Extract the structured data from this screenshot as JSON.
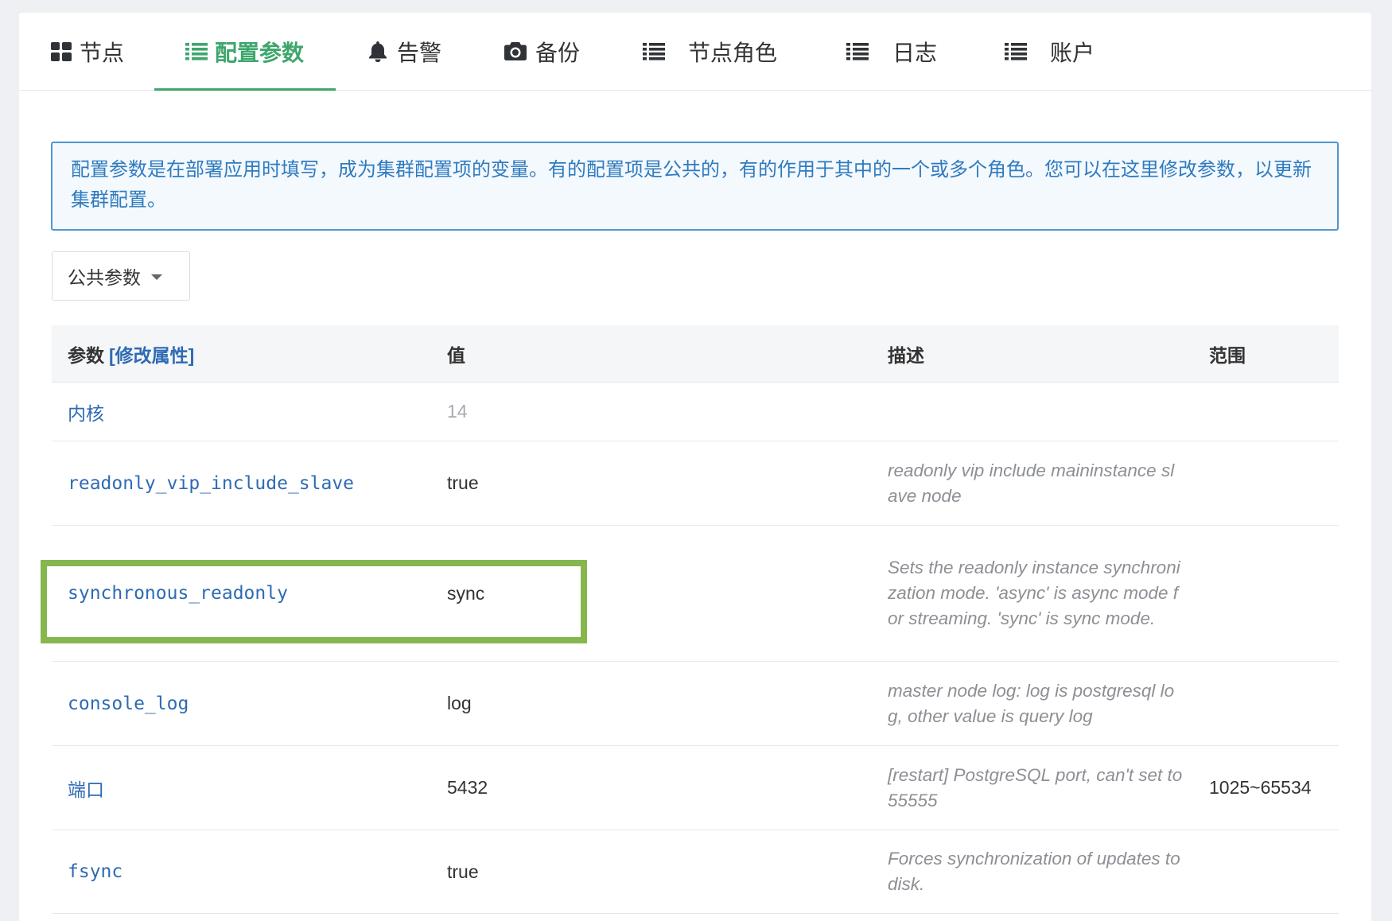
{
  "tabs": [
    {
      "label": "节点",
      "icon": "grid-icon"
    },
    {
      "label": "配置参数",
      "icon": "list-icon",
      "active": true
    },
    {
      "label": "告警",
      "icon": "bell-icon"
    },
    {
      "label": "备份",
      "icon": "camera-icon"
    },
    {
      "label": "节点角色",
      "icon": "list-icon"
    },
    {
      "label": "日志",
      "icon": "list-icon"
    },
    {
      "label": "账户",
      "icon": "list-icon"
    }
  ],
  "info": "配置参数是在部署应用时填写，成为集群配置项的变量。有的配置项是公共的，有的作用于其中的一个或多个角色。您可以在这里修改参数，以更新集群配置。",
  "filter": {
    "selected": "公共参数",
    "icon": "chevron-down-icon"
  },
  "table": {
    "headers": {
      "param": "参数",
      "edit_link": "[修改属性]",
      "value": "值",
      "desc": "描述",
      "range": "范围"
    },
    "rows": [
      {
        "name": "内核",
        "value": "14"
      },
      {
        "name": "readonly_vip_include_slave",
        "value": "true",
        "desc": "readonly vip include maininstance slave node"
      },
      {
        "name": "synchronous_readonly",
        "value": "sync",
        "desc": "Sets the readonly instance synchronization mode. 'async' is async mode for streaming. 'sync' is sync mode."
      },
      {
        "name": "console_log",
        "value": "log",
        "desc": "master node log: log is postgresql log, other value is query log"
      },
      {
        "name": "端口",
        "value": "5432",
        "desc": "[restart] PostgreSQL port, can't set to 55555",
        "range": "1025~65534"
      },
      {
        "name": "fsync",
        "value": "true",
        "desc": "Forces synchronization of updates to disk."
      }
    ]
  },
  "colors": {
    "accent": "#3ea66d",
    "link": "#2e6bb3",
    "info_border": "#4f97d1",
    "info_text": "#2f7bbf",
    "info_bg": "#f4f9fe",
    "highlight": "#86b74f"
  }
}
